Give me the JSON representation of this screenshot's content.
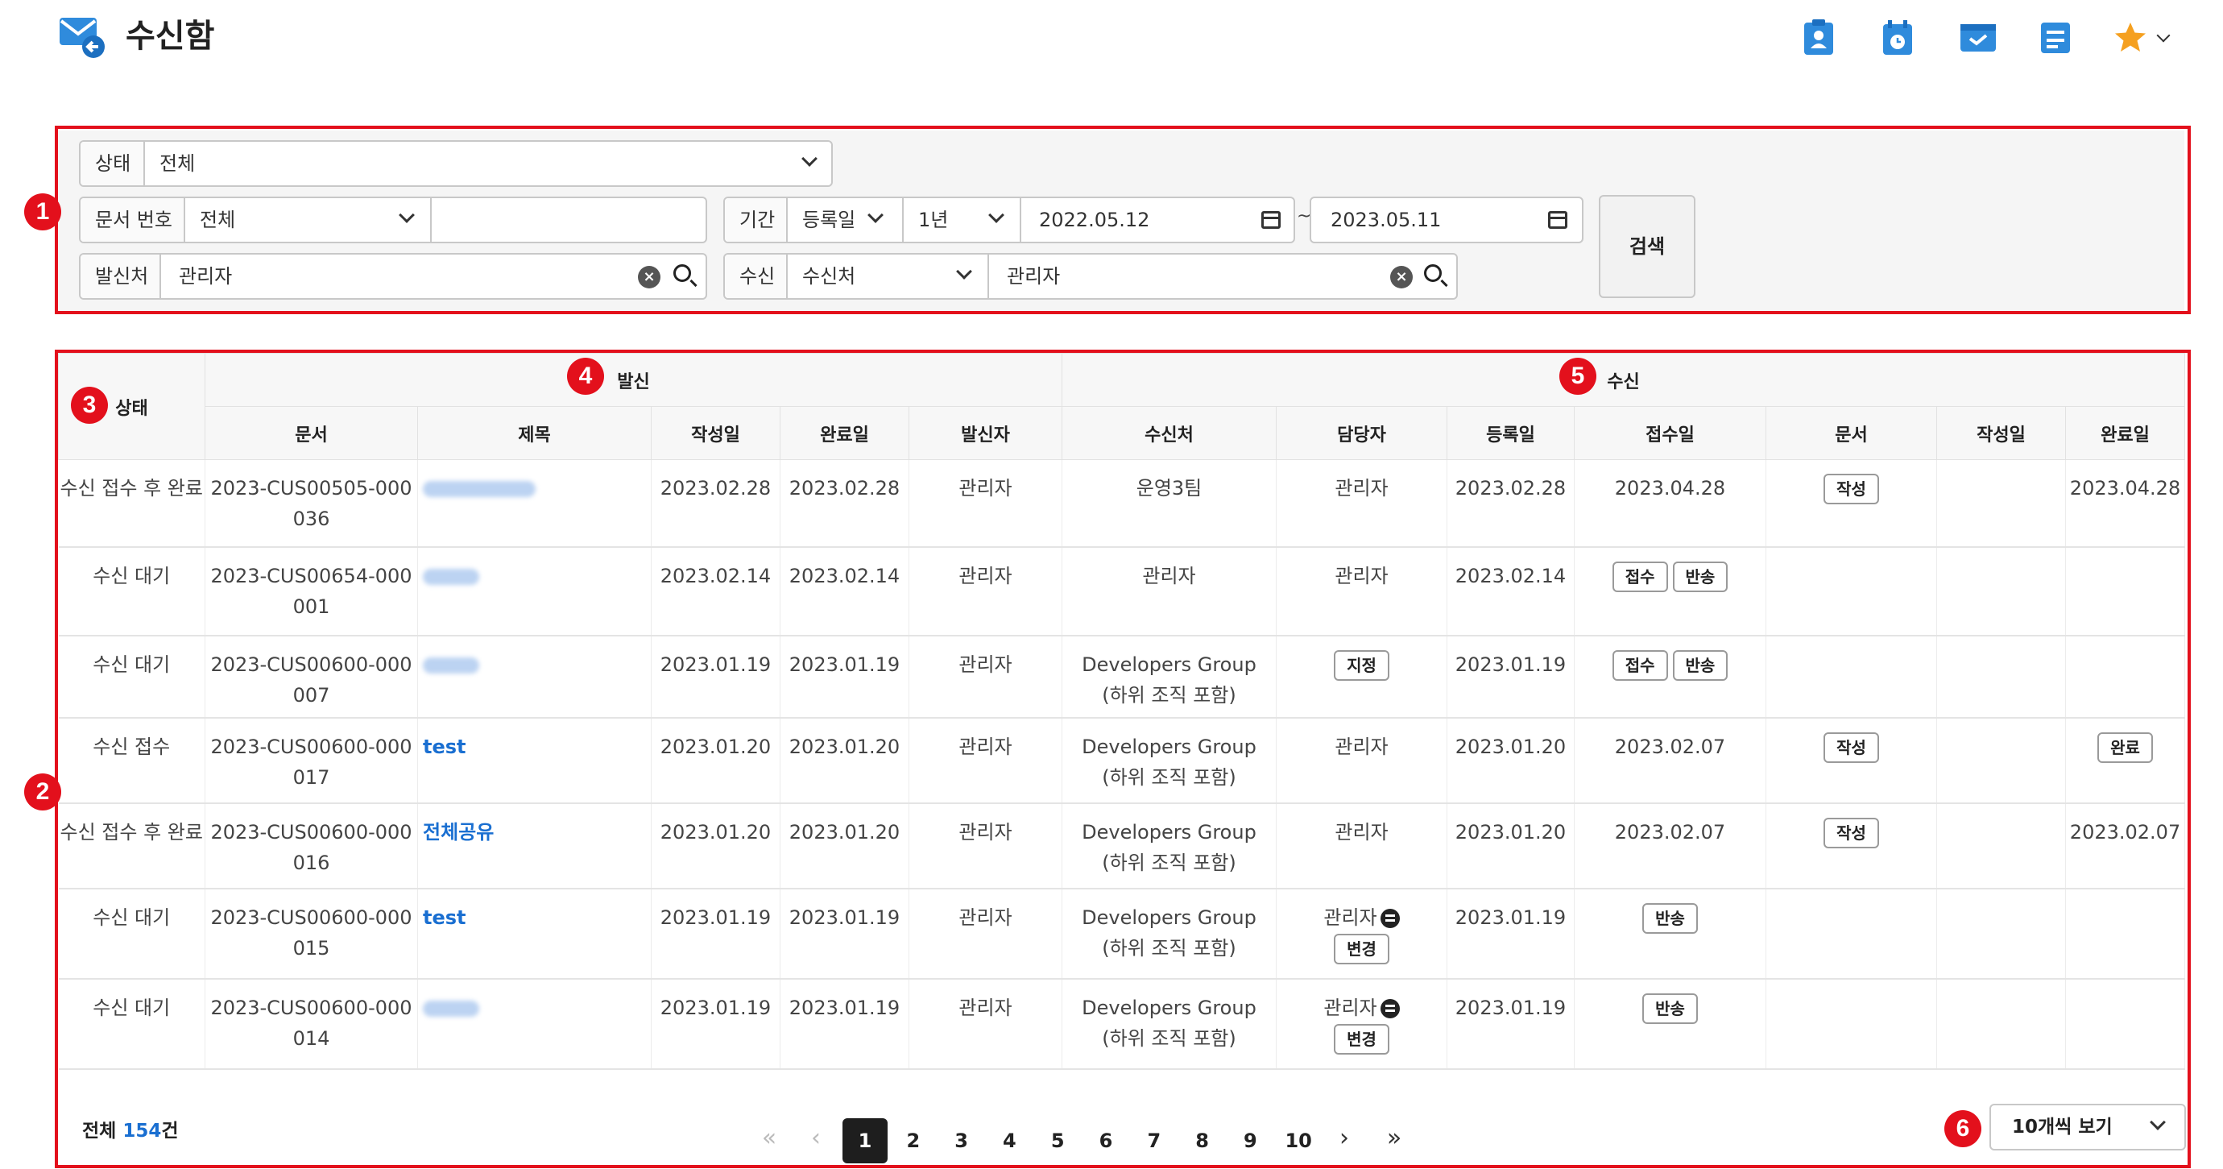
{
  "header": {
    "title": "수신함",
    "icons": [
      "mail-inbox-icon",
      "clipboard-user-icon",
      "calendar-clock-icon",
      "mail-board-icon",
      "document-list-icon",
      "favorite-star-icon"
    ]
  },
  "annotations": [
    "1",
    "2",
    "3",
    "4",
    "5",
    "6"
  ],
  "filter": {
    "status_label": "상태",
    "status_value": "전체",
    "docno_label": "문서 번호",
    "docno_type": "전체",
    "docno_value": "",
    "period_label": "기간",
    "period_type": "등록일",
    "period_range": "1년",
    "date_from": "2022.05.12",
    "date_sep": "~",
    "date_to": "2023.05.11",
    "sender_label": "발신처",
    "sender_value": "관리자",
    "recv_label": "수신",
    "recv_type": "수신처",
    "recv_value": "관리자",
    "search_button": "검색"
  },
  "table": {
    "group_status": "상태",
    "group_send": "발신",
    "group_recv": "수신",
    "columns": [
      "문서",
      "제목",
      "작성일",
      "완료일",
      "발신자",
      "수신처",
      "담당자",
      "등록일",
      "접수일",
      "문서",
      "작성일",
      "완료일"
    ],
    "rows": [
      {
        "status": "수신 접수 후 완료",
        "doc": "2023-CUS00505-000036",
        "title": "",
        "title_blur": true,
        "created": "2023.02.28",
        "done": "2023.02.28",
        "sender": "관리자",
        "recv": "운영3팀",
        "manager": "관리자",
        "manager_btn": "",
        "reg": "2023.02.28",
        "accept": "2023.04.28",
        "accept_btns": [],
        "rdoc_btn": "작성",
        "rcreated": "",
        "rdone": "2023.04.28",
        "rdone_btn": ""
      },
      {
        "status": "수신 대기",
        "doc": "2023-CUS00654-000001",
        "title": "",
        "title_blur": true,
        "created": "2023.02.14",
        "done": "2023.02.14",
        "sender": "관리자",
        "recv": "관리자",
        "manager": "관리자",
        "manager_btn": "",
        "reg": "2023.02.14",
        "accept": "",
        "accept_btns": [
          "접수",
          "반송"
        ],
        "rdoc_btn": "",
        "rcreated": "",
        "rdone": "",
        "rdone_btn": ""
      },
      {
        "status": "수신 대기",
        "doc": "2023-CUS00600-000007",
        "title": "",
        "title_blur": true,
        "created": "2023.01.19",
        "done": "2023.01.19",
        "sender": "관리자",
        "recv": "Developers Group (하위 조직 포함)",
        "manager": "",
        "manager_btn": "지정",
        "reg": "2023.01.19",
        "accept": "",
        "accept_btns": [
          "접수",
          "반송"
        ],
        "rdoc_btn": "",
        "rcreated": "",
        "rdone": "",
        "rdone_btn": ""
      },
      {
        "status": "수신 접수",
        "doc": "2023-CUS00600-000017",
        "title": "test",
        "title_blur": false,
        "created": "2023.01.20",
        "done": "2023.01.20",
        "sender": "관리자",
        "recv": "Developers Group (하위 조직 포함)",
        "manager": "관리자",
        "manager_btn": "",
        "reg": "2023.01.20",
        "accept": "2023.02.07",
        "accept_btns": [],
        "rdoc_btn": "작성",
        "rcreated": "",
        "rdone": "",
        "rdone_btn": "완료"
      },
      {
        "status": "수신 접수 후 완료",
        "doc": "2023-CUS00600-000016",
        "title": "전체공유",
        "title_blur": false,
        "created": "2023.01.20",
        "done": "2023.01.20",
        "sender": "관리자",
        "recv": "Developers Group (하위 조직 포함)",
        "manager": "관리자",
        "manager_btn": "",
        "reg": "2023.01.20",
        "accept": "2023.02.07",
        "accept_btns": [],
        "rdoc_btn": "작성",
        "rcreated": "",
        "rdone": "2023.02.07",
        "rdone_btn": ""
      },
      {
        "status": "수신 대기",
        "doc": "2023-CUS00600-000015",
        "title": "test",
        "title_blur": false,
        "created": "2023.01.19",
        "done": "2023.01.19",
        "sender": "관리자",
        "recv": "Developers Group (하위 조직 포함)",
        "manager": "관리자",
        "manager_chat": true,
        "manager_btn": "변경",
        "reg": "2023.01.19",
        "accept": "",
        "accept_btns": [
          "반송"
        ],
        "rdoc_btn": "",
        "rcreated": "",
        "rdone": "",
        "rdone_btn": ""
      },
      {
        "status": "수신 대기",
        "doc": "2023-CUS00600-000014",
        "title": "",
        "title_blur": true,
        "created": "2023.01.19",
        "done": "2023.01.19",
        "sender": "관리자",
        "recv": "Developers Group (하위 조직 포함)",
        "manager": "관리자",
        "manager_chat": true,
        "manager_btn": "변경",
        "reg": "2023.01.19",
        "accept": "",
        "accept_btns": [
          "반송"
        ],
        "rdoc_btn": "",
        "rcreated": "",
        "rdone": "",
        "rdone_btn": ""
      }
    ]
  },
  "footer": {
    "total_prefix": "전체 ",
    "total_count": "154",
    "total_suffix": "건",
    "pages": [
      "1",
      "2",
      "3",
      "4",
      "5",
      "6",
      "7",
      "8",
      "9",
      "10"
    ],
    "current_page": "1",
    "page_size": "10개씩 보기"
  },
  "colors": {
    "accent": "#1a6fd1",
    "annotation": "#e3101c",
    "icon_blue": "#2f8bdc",
    "star": "#f5a020"
  }
}
